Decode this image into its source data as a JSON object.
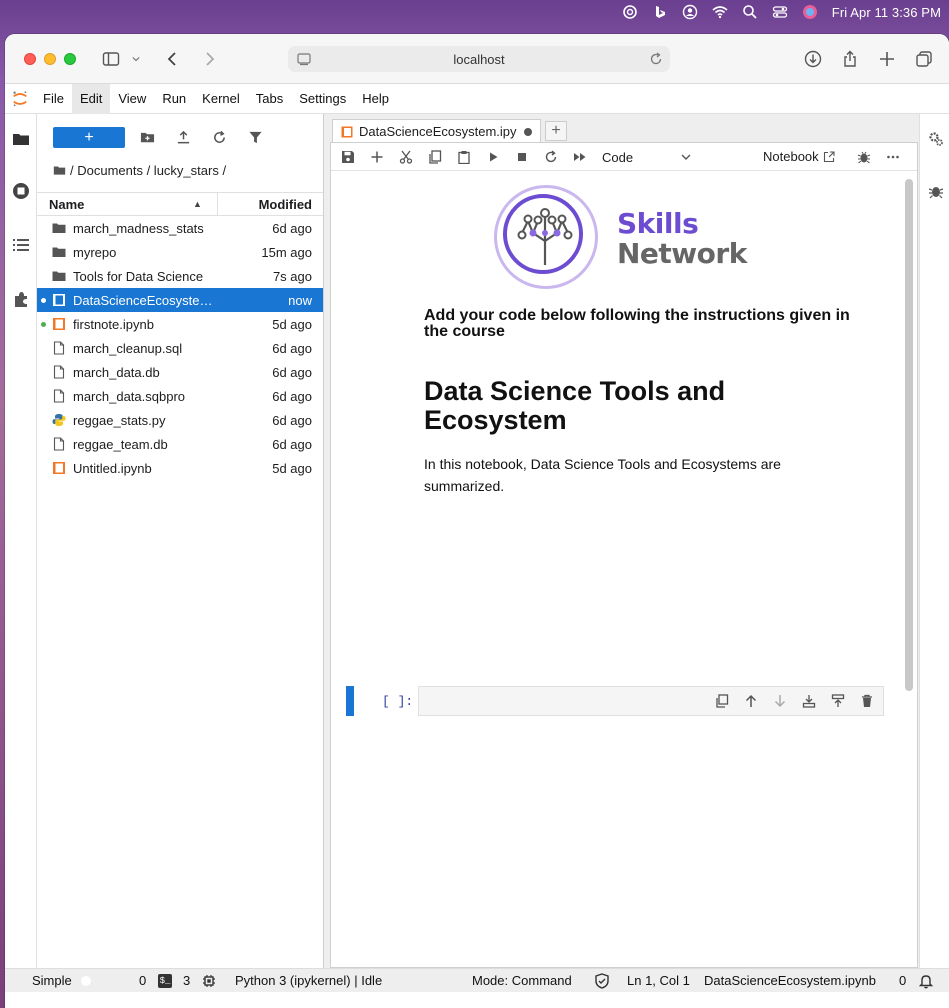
{
  "system": {
    "clock": "Fri Apr 11  3:36 PM"
  },
  "browser": {
    "url": "localhost"
  },
  "menu": {
    "items": [
      "File",
      "Edit",
      "View",
      "Run",
      "Kernel",
      "Tabs",
      "Settings",
      "Help"
    ],
    "active": "Edit"
  },
  "filebrowser": {
    "new_label": "+",
    "breadcrumb": "/ Documents / lucky_stars /",
    "col_name": "Name",
    "col_modified": "Modified",
    "files": [
      {
        "name": "march_madness_stats",
        "modified": "6d ago",
        "type": "folder"
      },
      {
        "name": "myrepo",
        "modified": "15m ago",
        "type": "folder"
      },
      {
        "name": "Tools for Data Science",
        "modified": "7s ago",
        "type": "folder"
      },
      {
        "name": "DataScienceEcosystem.ipynb",
        "modified": "now",
        "type": "notebook",
        "selected": true,
        "running": true
      },
      {
        "name": "firstnote.ipynb",
        "modified": "5d ago",
        "type": "notebook",
        "running": true
      },
      {
        "name": "march_cleanup.sql",
        "modified": "6d ago",
        "type": "file"
      },
      {
        "name": "march_data.db",
        "modified": "6d ago",
        "type": "file"
      },
      {
        "name": "march_data.sqbpro",
        "modified": "6d ago",
        "type": "file"
      },
      {
        "name": "reggae_stats.py",
        "modified": "6d ago",
        "type": "python"
      },
      {
        "name": "reggae_team.db",
        "modified": "6d ago",
        "type": "file"
      },
      {
        "name": "Untitled.ipynb",
        "modified": "5d ago",
        "type": "notebook"
      }
    ]
  },
  "notebook": {
    "tab_title": "DataScienceEcosystem.ipy",
    "cell_type": "Code",
    "kernel_label": "Notebook",
    "logo_line1": "Skills",
    "logo_line2": "Network",
    "heading4": "Add your code below following the instructions given in the course",
    "heading1": "Data Science Tools and Ecosystem",
    "paragraph": "In this notebook, Data Science Tools and Ecosystems are summarized.",
    "cell_prompt": "[ ]:"
  },
  "status": {
    "mode_toggle_label": "Simple",
    "count1": "0",
    "count2": "3",
    "kernel": "Python 3 (ipykernel) | Idle",
    "mode": "Mode: Command",
    "position": "Ln 1, Col 1",
    "filename": "DataScienceEcosystem.ipynb",
    "notifications": "0"
  },
  "colors": {
    "accent": "#1976d2",
    "brand_purple": "#6c4cd1",
    "notebook_orange": "#f37726",
    "running_green": "#4caf50"
  }
}
